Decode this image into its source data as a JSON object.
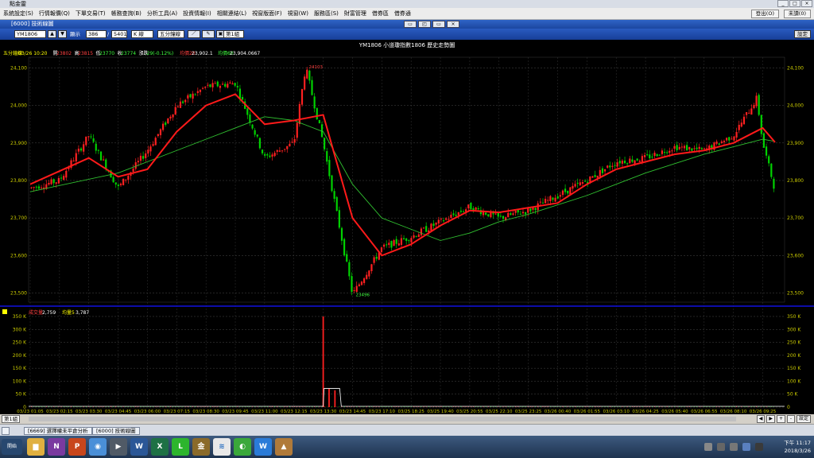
{
  "app": {
    "title": "點金靈",
    "window_buttons": [
      "_",
      "□",
      "×"
    ],
    "menu": [
      "系統設定(S)",
      "行情報價(Q)",
      "下單交易(T)",
      "帳務查詢(B)",
      "分析工具(A)",
      "投資情報(I)",
      "相關連結(L)",
      "視窗版面(F)",
      "視窗(W)",
      "服務區(S)",
      "財富管理",
      "借券區",
      "借券通"
    ],
    "right_buttons": [
      "登出(O)",
      "未讀(0)"
    ]
  },
  "window": {
    "title": "[6000] 技術線圖",
    "buttons": [
      "▭",
      "◰",
      "▭",
      "×"
    ]
  },
  "toolbar": {
    "symbol": "YM1806",
    "display_label": "顯示",
    "display_value": "386",
    "total_value": "5401",
    "chart_type": "K 線",
    "interval": "五分鐘線",
    "page": "第1組",
    "settings": "設定"
  },
  "chart": {
    "title": "YM1806 小道瓊指數1806 歷史走勢圖",
    "info": {
      "period": "五分鐘線",
      "datetime": "03/26 10:20",
      "open_label": "開",
      "open": "23802",
      "high_label": "高",
      "high": "23815",
      "low_label": "低",
      "low": "23770",
      "close_label": "收",
      "close": "23774",
      "change_label": "漲跌",
      "change": "-29(-0.12%)",
      "ma20_label": "均價20",
      "ma20": "23,902.1",
      "ma60_label": "均價60",
      "ma60": "23,904.0667"
    },
    "price_ticks": [
      "24,100",
      "24,000",
      "23,900",
      "23,800",
      "23,700",
      "23,600",
      "23,500"
    ],
    "peak_label": "24103",
    "trough_label": "23496",
    "volume_info": {
      "label": "成交量",
      "value": "2,759",
      "ma_label": "均量5",
      "ma_value": "3,787"
    },
    "volume_ticks": [
      "350 K",
      "300 K",
      "250 K",
      "200 K",
      "150 K",
      "100 K",
      "50 K",
      "0"
    ],
    "x_labels": [
      "03/23 01:05",
      "03/23 02:15",
      "03/23 03:30",
      "03/23 04:45",
      "03/23 06:00",
      "03/23 07:15",
      "03/23 08:30",
      "03/23 09:45",
      "03/23 11:00",
      "03/23 12:15",
      "03/23 13:30",
      "03/23 14:45",
      "03/23 17:10",
      "03/25 18:25",
      "03/25 19:40",
      "03/25 20:55",
      "03/25 22:10",
      "03/25 23:25",
      "03/26 00:40",
      "03/26 01:55",
      "03/26 03:10",
      "03/26 04:25",
      "03/26 05:40",
      "03/26 06:55",
      "03/26 08:10",
      "03/26 09:25"
    ],
    "colors": {
      "up": "#ff2020",
      "down": "#00d200",
      "ma20": "#ff1a1a",
      "ma60": "#30c030",
      "grid": "#5a5a5a",
      "axis_text": "#c8c800",
      "separator": "#1010e0"
    }
  },
  "chart_data": {
    "type": "candlestick",
    "title": "YM1806 小道瓊指數1806 歷史走勢圖",
    "x_range": [
      "03/23 01:05",
      "03/26 10:20"
    ],
    "ylim": [
      23480,
      24120
    ],
    "volume_ylim": [
      0,
      350000
    ],
    "close_path": [
      {
        "x": "03/23 01:05",
        "y": 23780
      },
      {
        "x": "03/23 02:15",
        "y": 23800
      },
      {
        "x": "03/23 03:30",
        "y": 23920
      },
      {
        "x": "03/23 04:45",
        "y": 23780
      },
      {
        "x": "03/23 06:00",
        "y": 23880
      },
      {
        "x": "03/23 07:15",
        "y": 24000
      },
      {
        "x": "03/23 08:30",
        "y": 24050
      },
      {
        "x": "03/23 09:45",
        "y": 24060
      },
      {
        "x": "03/23 11:00",
        "y": 23860
      },
      {
        "x": "03/23 12:15",
        "y": 23900
      },
      {
        "x": "03/23 12:45",
        "y": 24103
      },
      {
        "x": "03/23 13:30",
        "y": 23900
      },
      {
        "x": "03/23 14:45",
        "y": 23496
      },
      {
        "x": "03/23 17:10",
        "y": 23620
      },
      {
        "x": "03/25 18:25",
        "y": 23650
      },
      {
        "x": "03/25 19:40",
        "y": 23690
      },
      {
        "x": "03/25 20:55",
        "y": 23730
      },
      {
        "x": "03/25 22:10",
        "y": 23700
      },
      {
        "x": "03/25 23:25",
        "y": 23720
      },
      {
        "x": "03/26 00:40",
        "y": 23760
      },
      {
        "x": "03/26 01:55",
        "y": 23800
      },
      {
        "x": "03/26 03:10",
        "y": 23850
      },
      {
        "x": "03/26 04:25",
        "y": 23860
      },
      {
        "x": "03/26 05:40",
        "y": 23890
      },
      {
        "x": "03/26 06:55",
        "y": 23880
      },
      {
        "x": "03/26 08:10",
        "y": 23920
      },
      {
        "x": "03/26 09:10",
        "y": 24020
      },
      {
        "x": "03/26 09:25",
        "y": 23900
      },
      {
        "x": "03/26 10:20",
        "y": 23774
      }
    ],
    "ma20_path": [
      {
        "x": "03/23 01:05",
        "y": 23790
      },
      {
        "x": "03/23 03:30",
        "y": 23860
      },
      {
        "x": "03/23 04:45",
        "y": 23810
      },
      {
        "x": "03/23 06:00",
        "y": 23830
      },
      {
        "x": "03/23 07:15",
        "y": 23930
      },
      {
        "x": "03/23 08:30",
        "y": 24000
      },
      {
        "x": "03/23 09:45",
        "y": 24030
      },
      {
        "x": "03/23 11:00",
        "y": 23950
      },
      {
        "x": "03/23 12:15",
        "y": 23960
      },
      {
        "x": "03/23 13:30",
        "y": 23975
      },
      {
        "x": "03/23 14:45",
        "y": 23700
      },
      {
        "x": "03/23 17:10",
        "y": 23600
      },
      {
        "x": "03/25 18:25",
        "y": 23630
      },
      {
        "x": "03/25 19:40",
        "y": 23680
      },
      {
        "x": "03/25 20:55",
        "y": 23720
      },
      {
        "x": "03/25 22:10",
        "y": 23715
      },
      {
        "x": "03/26 00:40",
        "y": 23740
      },
      {
        "x": "03/26 01:55",
        "y": 23790
      },
      {
        "x": "03/26 03:10",
        "y": 23830
      },
      {
        "x": "03/26 05:40",
        "y": 23870
      },
      {
        "x": "03/26 06:55",
        "y": 23880
      },
      {
        "x": "03/26 08:10",
        "y": 23900
      },
      {
        "x": "03/26 09:25",
        "y": 23940
      },
      {
        "x": "03/26 10:20",
        "y": 23902
      }
    ],
    "ma60_path": [
      {
        "x": "03/23 01:05",
        "y": 23770
      },
      {
        "x": "03/23 04:45",
        "y": 23820
      },
      {
        "x": "03/23 07:15",
        "y": 23880
      },
      {
        "x": "03/23 09:45",
        "y": 23940
      },
      {
        "x": "03/23 11:00",
        "y": 23970
      },
      {
        "x": "03/23 12:15",
        "y": 23960
      },
      {
        "x": "03/23 13:30",
        "y": 23930
      },
      {
        "x": "03/23 14:45",
        "y": 23790
      },
      {
        "x": "03/23 17:10",
        "y": 23700
      },
      {
        "x": "03/25 19:40",
        "y": 23640
      },
      {
        "x": "03/25 20:55",
        "y": 23660
      },
      {
        "x": "03/25 22:10",
        "y": 23690
      },
      {
        "x": "03/25 23:25",
        "y": 23710
      },
      {
        "x": "03/26 01:55",
        "y": 23760
      },
      {
        "x": "03/26 04:25",
        "y": 23820
      },
      {
        "x": "03/26 06:55",
        "y": 23870
      },
      {
        "x": "03/26 08:10",
        "y": 23890
      },
      {
        "x": "03/26 09:25",
        "y": 23910
      },
      {
        "x": "03/26 10:20",
        "y": 23904
      }
    ],
    "volume": {
      "baseline": 2000,
      "spikes": [
        {
          "x": "03/23 13:30",
          "y": 350000
        },
        {
          "x": "03/23 13:45",
          "y": 72000
        },
        {
          "x": "03/23 14:00",
          "y": 65000
        }
      ]
    }
  },
  "statusbar": {
    "page": "第1組",
    "controls": [
      "◀",
      "▶",
      "+",
      "-",
      "設定"
    ]
  },
  "subtabs": [
    "[6669] 選擇權未平倉分析",
    "[6000] 技術線圖"
  ],
  "taskbar": {
    "start": "開始",
    "apps": [
      {
        "icon": "folder-icon",
        "color": "#e0b040",
        "glyph": "▆"
      },
      {
        "icon": "onenote-icon",
        "color": "#7a3aa0",
        "glyph": "N"
      },
      {
        "icon": "powerpoint-icon",
        "color": "#c8461c",
        "glyph": "P"
      },
      {
        "icon": "chrome-icon",
        "color": "#4a8fd8",
        "glyph": "◉"
      },
      {
        "icon": "media-icon",
        "color": "#505a66",
        "glyph": "▶"
      },
      {
        "icon": "word-icon",
        "color": "#2b5797",
        "glyph": "W"
      },
      {
        "icon": "excel-icon",
        "color": "#1e7145",
        "glyph": "X"
      },
      {
        "icon": "line-icon",
        "color": "#2db52d",
        "glyph": "L"
      },
      {
        "icon": "trading-app-icon",
        "color": "#8a6a2a",
        "glyph": "金"
      },
      {
        "icon": "stream-icon",
        "color": "#e8e8e8",
        "glyph": "≋"
      },
      {
        "icon": "green-app-icon",
        "color": "#3aa83a",
        "glyph": "◐"
      },
      {
        "icon": "wps-icon",
        "color": "#2a7bd8",
        "glyph": "W"
      },
      {
        "icon": "fox-app-icon",
        "color": "#b07a3a",
        "glyph": "▲"
      }
    ],
    "time": "下午 11:17",
    "date": "2018/3/26"
  }
}
